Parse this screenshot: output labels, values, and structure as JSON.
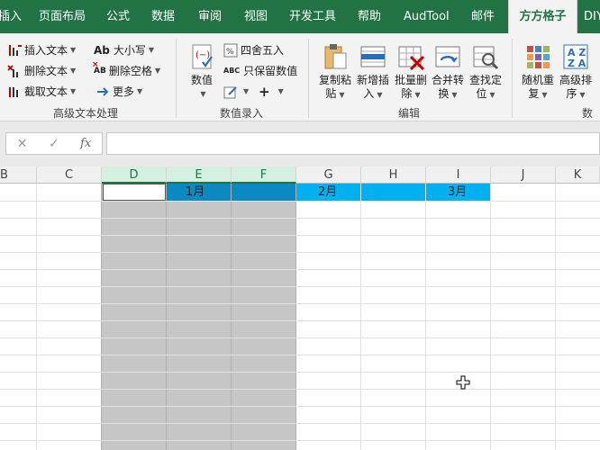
{
  "tabs": [
    "插入",
    "页面布局",
    "公式",
    "数据",
    "审阅",
    "视图",
    "开发工具",
    "帮助",
    "AudTool",
    "邮件",
    "方方格子",
    "DIY"
  ],
  "ribbon": {
    "text_group": {
      "label": "高级文本处理",
      "insert_text": "插入文本",
      "delete_text": "删除文本",
      "extract_text": "截取文本",
      "case_prefix": "Ab",
      "case_label": "大小写",
      "delete_space_prefix": "AB",
      "delete_space": "删除空格",
      "more": "更多"
    },
    "value_group": {
      "label": "数值录入",
      "value_line1": "数值",
      "round": "四舍五入",
      "keep_values_prefix": "ABC",
      "keep_values": "只保留数值",
      "plus": "+"
    },
    "edit_group": {
      "label": "编辑",
      "copy_paste": [
        "复制粘",
        "贴"
      ],
      "add_insert": [
        "新增插",
        "入"
      ],
      "batch_delete": [
        "批量删",
        "除"
      ],
      "merge_convert": [
        "合并转",
        "换"
      ],
      "find_locate": [
        "查找定",
        "位"
      ]
    },
    "random_group": {
      "label": "数",
      "random_repeat": [
        "随机重",
        "复"
      ],
      "advanced_sort": [
        "高级排",
        "序"
      ],
      "az_top": "A Z",
      "az_bottom": "Z A"
    }
  },
  "formula_bar": {
    "cancel": "✕",
    "confirm": "✓",
    "fx": "fx",
    "value": ""
  },
  "columns": [
    "B",
    "C",
    "D",
    "E",
    "F",
    "G",
    "H",
    "I",
    "J",
    "K"
  ],
  "cells": {
    "e1": "1月",
    "g1": "2月",
    "i1": "3月"
  },
  "colors": {
    "ribbon_green": "#217346",
    "header_band_blue": "#00b0f0",
    "merged_band_blue": "#0a8ac0",
    "selection_gray": "#c6c6c6"
  }
}
